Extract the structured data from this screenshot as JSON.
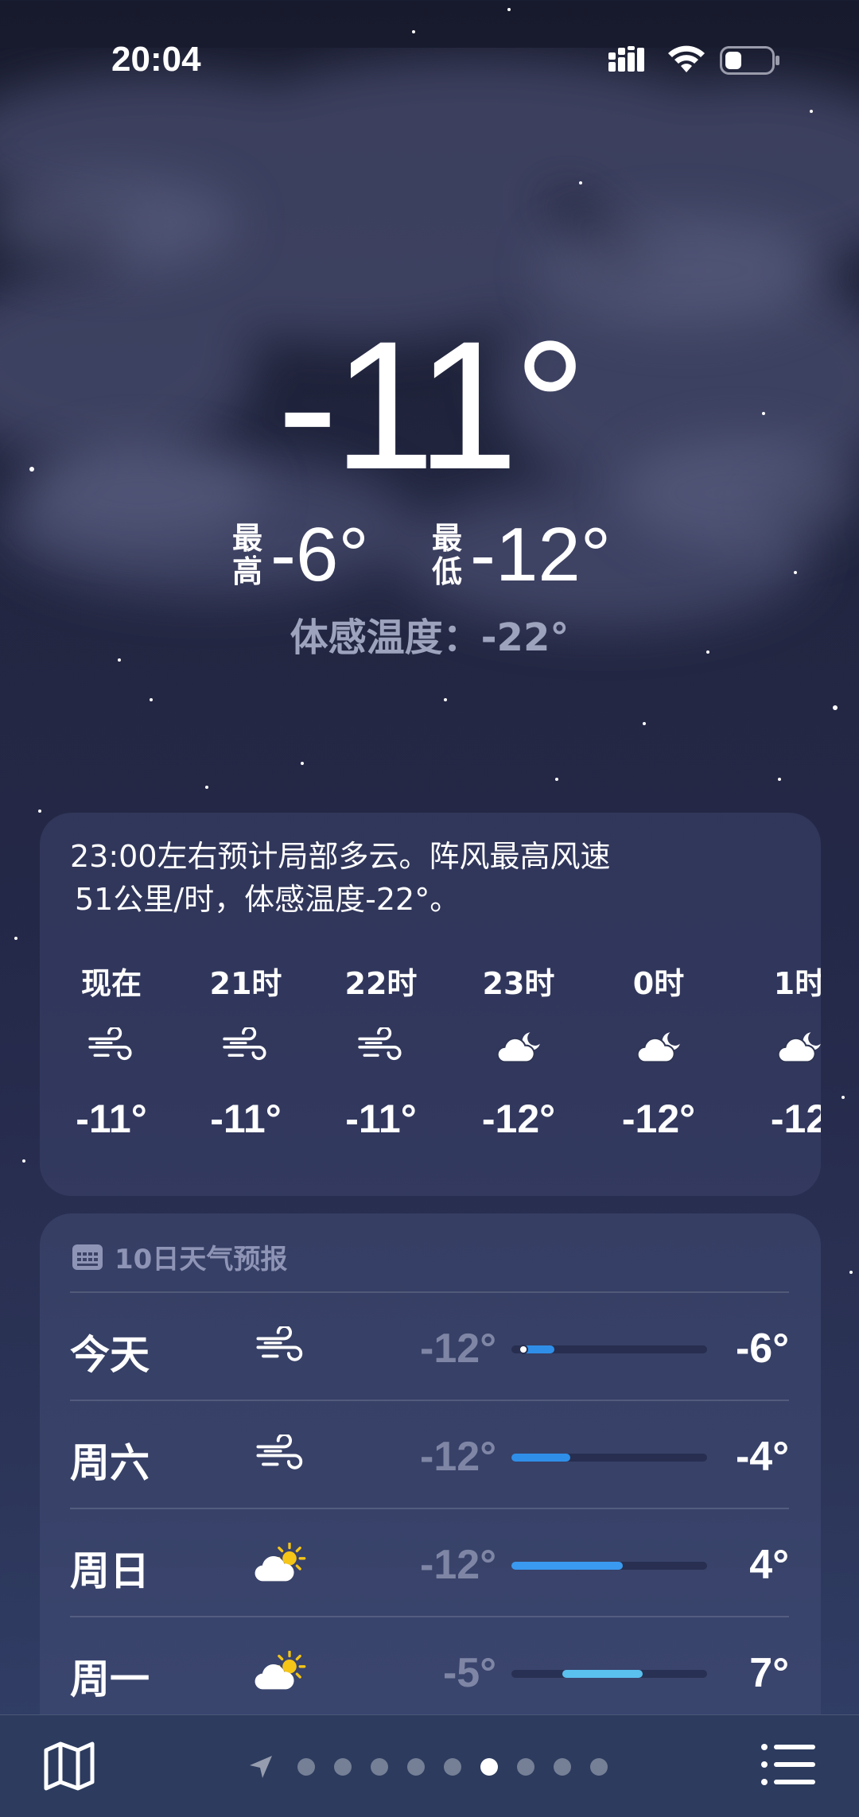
{
  "status_bar": {
    "time": "20:04"
  },
  "current": {
    "temperature": "-11°",
    "high_label": "最高",
    "high_value": "-6°",
    "low_label": "最低",
    "low_value": "-12°",
    "feels_like": "体感温度：-22°"
  },
  "hourly": {
    "summary_line1": "23:00左右预计局部多云。阵风最高风速",
    "summary_line2": "51公里/时，体感温度-22°。",
    "items": [
      {
        "label": "现在",
        "icon": "wind-icon",
        "temp": "-11°"
      },
      {
        "label": "21时",
        "icon": "wind-icon",
        "temp": "-11°"
      },
      {
        "label": "22时",
        "icon": "wind-icon",
        "temp": "-11°"
      },
      {
        "label": "23时",
        "icon": "partly-cloudy-night-icon",
        "temp": "-12°"
      },
      {
        "label": "0时",
        "icon": "partly-cloudy-night-icon",
        "temp": "-12°"
      },
      {
        "label": "1时",
        "icon": "partly-cloudy-night-icon",
        "temp": "-12"
      }
    ]
  },
  "daily": {
    "header": "10日天气预报",
    "days": [
      {
        "name": "今天",
        "icon": "wind-icon",
        "low": "-12°",
        "high": "-6°",
        "bar_start": 0.05,
        "bar_end": 0.22,
        "bar_color": "#2f8fe8",
        "current_dot": 0.06
      },
      {
        "name": "周六",
        "icon": "wind-icon",
        "low": "-12°",
        "high": "-4°",
        "bar_start": 0.0,
        "bar_end": 0.3,
        "bar_color": "#2f8fe8"
      },
      {
        "name": "周日",
        "icon": "partly-sunny-icon",
        "low": "-12°",
        "high": "4°",
        "bar_start": 0.0,
        "bar_end": 0.57,
        "bar_color": "#3a9af0"
      },
      {
        "name": "周一",
        "icon": "partly-sunny-icon",
        "low": "-5°",
        "high": "7°",
        "bar_start": 0.26,
        "bar_end": 0.67,
        "bar_color": "#5ac0ee"
      }
    ]
  },
  "toolbar": {
    "page_count": 9,
    "active_page": 6
  }
}
